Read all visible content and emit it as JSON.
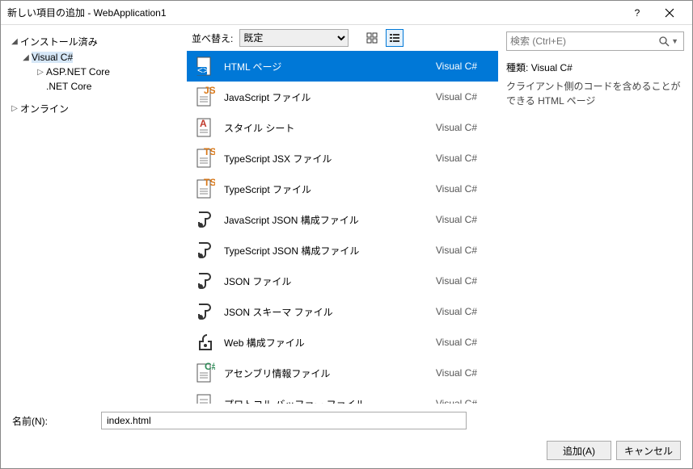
{
  "title": "新しい項目の追加 - WebApplication1",
  "leftTree": {
    "installed": "インストール済み",
    "visualcs": "Visual C#",
    "aspnetcore": "ASP.NET Core",
    "netcore": ".NET Core",
    "online": "オンライン"
  },
  "toolbar": {
    "sortLabel": "並べ替え:",
    "sortValue": "既定"
  },
  "items": [
    {
      "label": "HTML ページ",
      "lang": "Visual C#",
      "selected": true
    },
    {
      "label": "JavaScript ファイル",
      "lang": "Visual C#"
    },
    {
      "label": "スタイル シート",
      "lang": "Visual C#"
    },
    {
      "label": "TypeScript JSX ファイル",
      "lang": "Visual C#"
    },
    {
      "label": "TypeScript ファイル",
      "lang": "Visual C#"
    },
    {
      "label": "JavaScript JSON 構成ファイル",
      "lang": "Visual C#"
    },
    {
      "label": "TypeScript JSON 構成ファイル",
      "lang": "Visual C#"
    },
    {
      "label": "JSON ファイル",
      "lang": "Visual C#"
    },
    {
      "label": "JSON スキーマ ファイル",
      "lang": "Visual C#"
    },
    {
      "label": "Web 構成ファイル",
      "lang": "Visual C#"
    },
    {
      "label": "アセンブリ情報ファイル",
      "lang": "Visual C#"
    },
    {
      "label": "プロトコル バッファー ファイル",
      "lang": "Visual C#"
    }
  ],
  "search": {
    "placeholder": "検索 (Ctrl+E)"
  },
  "info": {
    "typeLabel": "種類:",
    "typeValue": "Visual C#",
    "description": "クライアント側のコードを含めることができる HTML ページ"
  },
  "nameRow": {
    "label": "名前(N):",
    "value": "index.html"
  },
  "buttons": {
    "add": "追加(A)",
    "cancel": "キャンセル"
  }
}
